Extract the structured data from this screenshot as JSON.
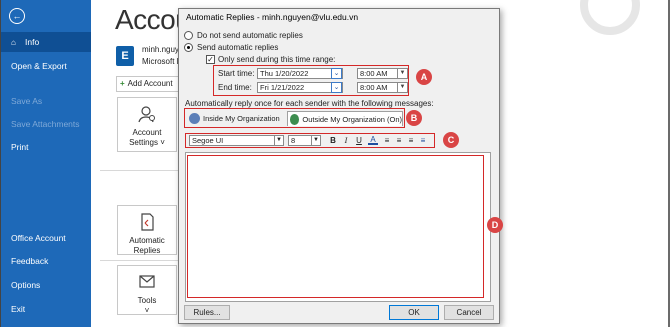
{
  "sidebar": {
    "back_icon": "back-arrow-icon",
    "items": [
      {
        "label": "Info",
        "icon": "home-icon",
        "active": true
      },
      {
        "label": "Open & Export"
      },
      {
        "label": "Save As",
        "disabled": true
      },
      {
        "label": "Save Attachments",
        "disabled": true
      },
      {
        "label": "Print"
      },
      {
        "label": "Office Account"
      },
      {
        "label": "Feedback"
      },
      {
        "label": "Options"
      },
      {
        "label": "Exit"
      }
    ]
  },
  "background": {
    "page_title": "Accou",
    "account_name": "minh.nguy",
    "account_sub": "Microsoft E",
    "add_account_label": "Add Account",
    "tiles": [
      {
        "label1": "Account",
        "label2": "Settings ˅"
      },
      {
        "label1": "Automatic",
        "label2": "Replies"
      },
      {
        "label1": "Tools",
        "label2": "˅"
      }
    ]
  },
  "dialog": {
    "title": "Automatic Replies - minh.nguyen@vlu.edu.vn",
    "no_send_label": "Do not send automatic replies",
    "send_label": "Send automatic replies",
    "only_send_label": "Only send during this time range:",
    "start_label": "Start time:",
    "end_label": "End time:",
    "start_date": "Thu 1/20/2022",
    "end_date": "Fri 1/21/2022",
    "start_time": "8:00 AM",
    "end_time": "8:00 AM",
    "reply_label": "Automatically reply once for each sender with the following messages:",
    "tab_inside": "Inside My Organization",
    "tab_outside": "Outside My Organization (On)",
    "font_name": "Segoe UI",
    "font_size": "8",
    "format_buttons": [
      "B",
      "I",
      "U",
      "A",
      "≡",
      "≡",
      "≡",
      "≡"
    ],
    "rules_label": "Rules...",
    "ok_label": "OK",
    "cancel_label": "Cancel"
  },
  "markers": [
    "A",
    "B",
    "C",
    "D"
  ],
  "colors": {
    "sidebar": "#1e69b8",
    "sidebar_active": "#0f4f94",
    "highlight_red": "#d42828",
    "marker_red": "#d94545"
  }
}
